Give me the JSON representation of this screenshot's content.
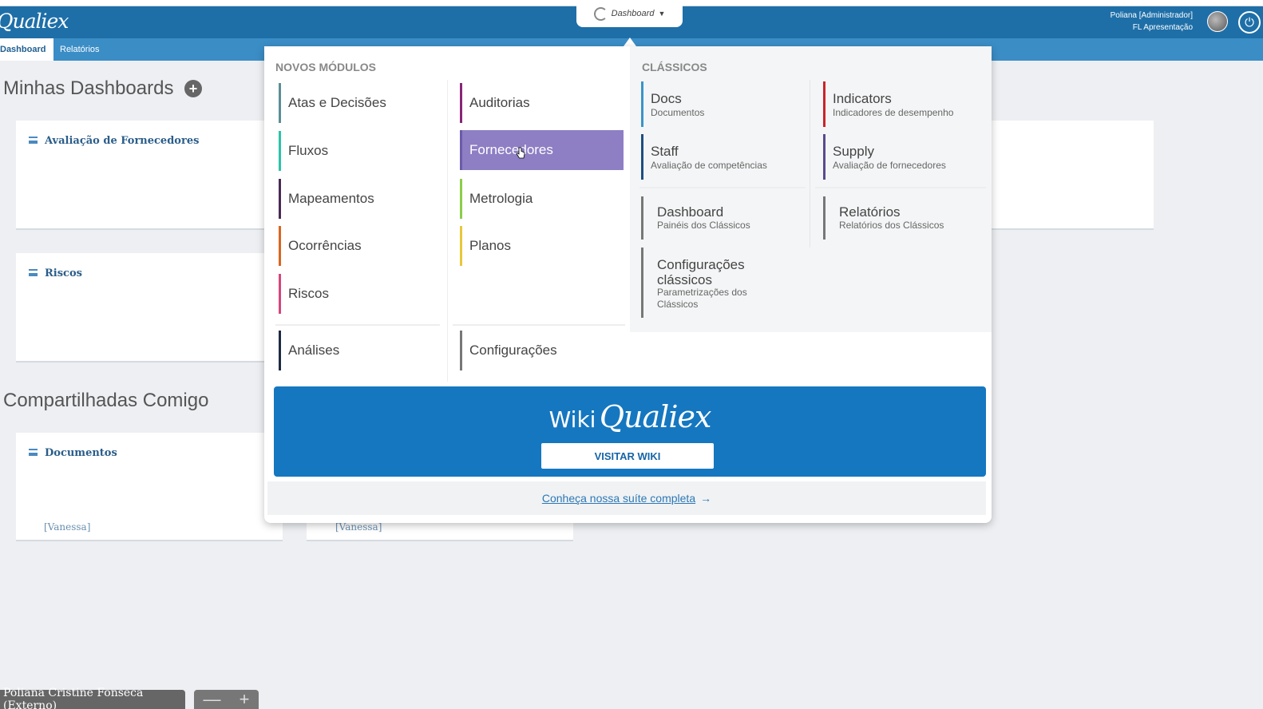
{
  "app": {
    "logo": "Qualiex"
  },
  "header": {
    "dashboard_pill": "Dashboard",
    "user_line1": "Poliana [Administrador]",
    "user_line2": "FL Apresentação"
  },
  "tabs": [
    {
      "label": "Dashboard"
    },
    {
      "label": "Relatórios"
    }
  ],
  "page": {
    "my_dashboards_title": "Minhas Dashboards",
    "shared_title": "Compartilhadas Comigo",
    "cards": [
      {
        "title": "Avaliação de Fornecedores"
      },
      {
        "title": "Riscos"
      },
      {
        "title": "Documentos",
        "footer": "[Vanessa]"
      }
    ],
    "second_card_footer": "[Vanessa]"
  },
  "dropdown": {
    "new_modules_heading": "NOVOS MÓDULOS",
    "classic_heading": "CLÁSSICOS",
    "new_modules": [
      {
        "label": "Atas e Decisões",
        "color": "#5a8f95"
      },
      {
        "label": "Fluxos",
        "color": "#2ac4a8"
      },
      {
        "label": "Mapeamentos",
        "color": "#4a2a55"
      },
      {
        "label": "Ocorrências",
        "color": "#d9661f"
      },
      {
        "label": "Riscos",
        "color": "#d6457d"
      },
      {
        "label": "Auditorias",
        "color": "#8a2478"
      },
      {
        "label": "Fornecedores",
        "color": "#6c5aa8",
        "highlighted": true
      },
      {
        "label": "Metrologia",
        "color": "#8ccd4a"
      },
      {
        "label": "Planos",
        "color": "#e8c83a"
      },
      {
        "label": "Análises",
        "color": "#1e2a44"
      },
      {
        "label": "Configurações",
        "color": "#777777"
      }
    ],
    "classics": [
      {
        "title": "Docs",
        "subtitle": "Documentos",
        "color": "#3c94c8"
      },
      {
        "title": "Indicators",
        "subtitle": "Indicadores de desempenho",
        "color": "#c8252a"
      },
      {
        "title": "Staff",
        "subtitle": "Avaliação de competências",
        "color": "#1e4e80"
      },
      {
        "title": "Supply",
        "subtitle": "Avaliação de fornecedores",
        "color": "#5a4a8e"
      },
      {
        "title": "Dashboard",
        "subtitle": "Painéis dos Clássicos",
        "color": "#777777"
      },
      {
        "title": "Relatórios",
        "subtitle": "Relatórios dos Clássicos",
        "color": "#777777"
      },
      {
        "title": "Configurações clássicos",
        "subtitle": "Parametrizações dos Clássicos",
        "color": "#777777"
      }
    ],
    "wiki": {
      "prefix": "Wiki",
      "brand": "Qualiex",
      "button": "VISITAR WIKI"
    },
    "suite_link": "Conheça nossa suíte completa",
    "suite_arrow": "→"
  },
  "footer": {
    "user": "Poliana Cristine Fonseca (Externo)",
    "zoom_out": "—",
    "zoom_in": "+"
  },
  "icons": {
    "plus": "plus-circle-icon",
    "power": "power-icon",
    "menu": "hamburger-icon"
  }
}
